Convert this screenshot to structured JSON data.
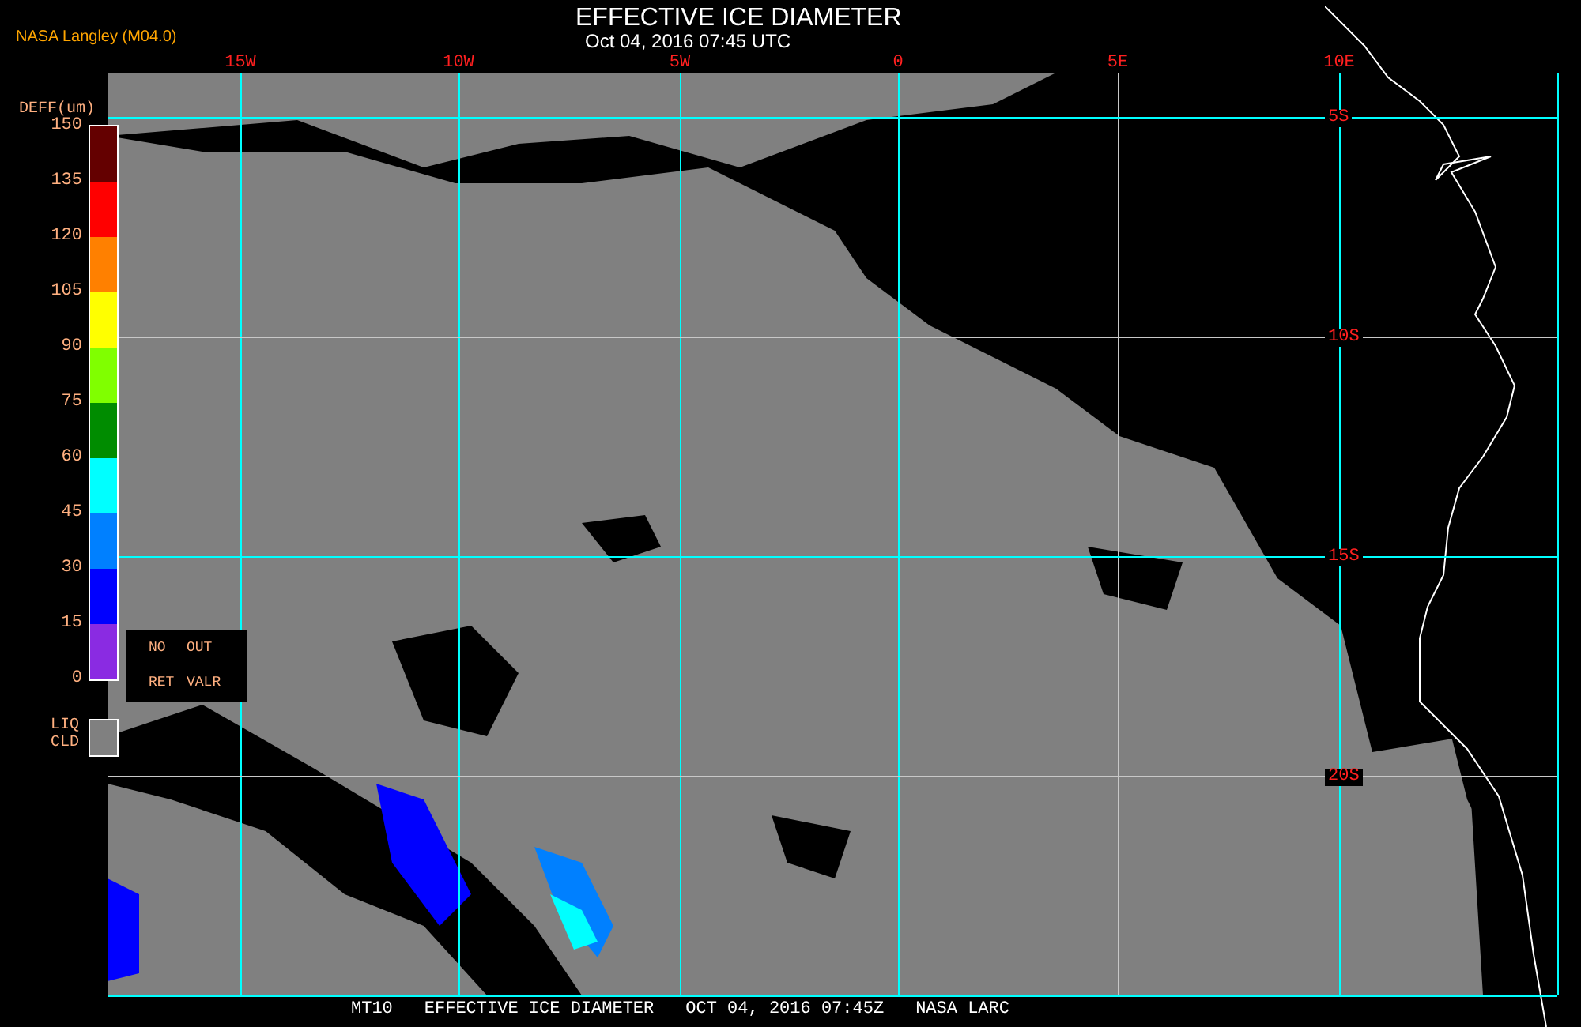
{
  "header": {
    "source": "NASA Langley (M04.0)",
    "title": "EFFECTIVE ICE DIAMETER",
    "datetime": "Oct 04, 2016 07:45 UTC"
  },
  "map": {
    "lon_labels": [
      "15W",
      "10W",
      "5W",
      "0",
      "5E",
      "10E"
    ],
    "lat_labels": [
      "5S",
      "10S",
      "15S",
      "20S"
    ]
  },
  "legend": {
    "title": "DEFF(um)",
    "ticks": [
      "150",
      "135",
      "120",
      "105",
      "90",
      "75",
      "60",
      "45",
      "30",
      "15",
      "0"
    ],
    "segments": [
      {
        "color": "#640000"
      },
      {
        "color": "#ff0000"
      },
      {
        "color": "#ff8000"
      },
      {
        "color": "#ffff00"
      },
      {
        "color": "#80ff00"
      },
      {
        "color": "#008c00"
      },
      {
        "color": "#00ffff"
      },
      {
        "color": "#0080ff"
      },
      {
        "color": "#0000ff"
      },
      {
        "color": "#8a2be2"
      }
    ]
  },
  "no_retrieval": [
    "NO",
    "OUT",
    "RET",
    "VALR"
  ],
  "liquid_cloud": {
    "lines": [
      "LIQ",
      "CLD"
    ],
    "color": "#808080"
  },
  "footer": [
    "MT10",
    "EFFECTIVE ICE DIAMETER",
    "OCT 04, 2016 07:45Z",
    "NASA LARC"
  ]
}
